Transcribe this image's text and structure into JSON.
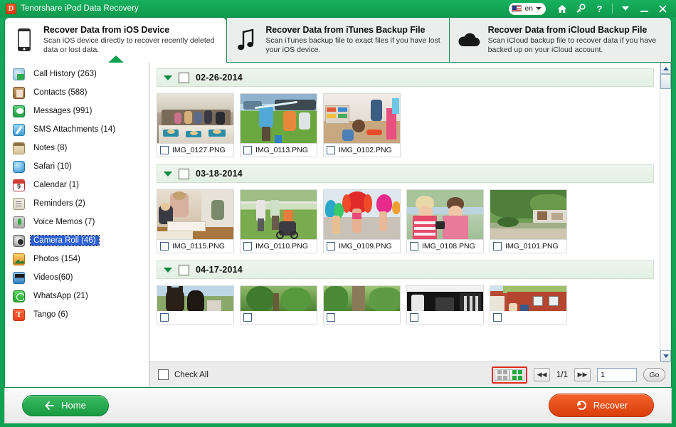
{
  "titlebar": {
    "app_icon": "app-logo-icon",
    "title": "Tenorshare iPod Data Recovery",
    "language": "en",
    "icons": [
      "home-icon",
      "key-icon",
      "help-icon",
      "chevron-down-icon",
      "minimize-icon",
      "close-icon"
    ]
  },
  "tabs": [
    {
      "title": "Recover Data from iOS Device",
      "subtitle": "Scan iOS device directly to recover recently deleted data or lost data.",
      "icon": "iphone-icon",
      "active": true
    },
    {
      "title": "Recover Data from iTunes Backup File",
      "subtitle": "Scan iTunes backup file to exact files if you have lost your iOS device.",
      "icon": "music-note-icon",
      "active": false
    },
    {
      "title": "Recover Data from iCloud Backup File",
      "subtitle": "Scan iCloud backup file to recover data if you have backed up on your iCloud account.",
      "icon": "cloud-icon",
      "active": false
    }
  ],
  "sidebar": {
    "items": [
      {
        "label": "Call History (263)",
        "icon": "call-history-icon",
        "selected": false
      },
      {
        "label": "Contacts (588)",
        "icon": "contacts-icon",
        "selected": false
      },
      {
        "label": "Messages (991)",
        "icon": "messages-icon",
        "selected": false
      },
      {
        "label": "SMS Attachments (14)",
        "icon": "sms-attachments-icon",
        "selected": false
      },
      {
        "label": "Notes (8)",
        "icon": "notes-icon",
        "selected": false
      },
      {
        "label": "Safari (10)",
        "icon": "safari-icon",
        "selected": false
      },
      {
        "label": "Calendar (1)",
        "icon": "calendar-icon",
        "selected": false
      },
      {
        "label": "Reminders (2)",
        "icon": "reminders-icon",
        "selected": false
      },
      {
        "label": "Voice Memos (7)",
        "icon": "voice-memos-icon",
        "selected": false
      },
      {
        "label": "Camera Roll (46)",
        "icon": "camera-roll-icon",
        "selected": true
      },
      {
        "label": "Photos (154)",
        "icon": "photos-icon",
        "selected": false
      },
      {
        "label": "Videos(60)",
        "icon": "videos-icon",
        "selected": false
      },
      {
        "label": "WhatsApp (21)",
        "icon": "whatsapp-icon",
        "selected": false
      },
      {
        "label": "Tango (6)",
        "icon": "tango-icon",
        "selected": false
      }
    ]
  },
  "gallery": {
    "groups": [
      {
        "date": "02-26-2014",
        "files": [
          {
            "name": "IMG_0127.PNG",
            "scene": "family-dinner-table"
          },
          {
            "name": "IMG_0113.PNG",
            "scene": "kids-water-play-lawn"
          },
          {
            "name": "IMG_0102.PNG",
            "scene": "children-playroom"
          }
        ]
      },
      {
        "date": "03-18-2014",
        "files": [
          {
            "name": "IMG_0115.PNG",
            "scene": "woman-child-reading"
          },
          {
            "name": "IMG_0110.PNG",
            "scene": "family-with-stroller"
          },
          {
            "name": "IMG_0109.PNG",
            "scene": "carnival-dancers"
          },
          {
            "name": "IMG_0108.PNG",
            "scene": "two-girls-outdoors"
          },
          {
            "name": "IMG_0101.PNG",
            "scene": "garden-house-trees"
          }
        ]
      },
      {
        "date": "04-17-2014",
        "files": [
          {
            "name": "",
            "scene": "horses-field"
          },
          {
            "name": "",
            "scene": "green-trees"
          },
          {
            "name": "",
            "scene": "tree-trunk-foliage"
          },
          {
            "name": "",
            "scene": "dark-interior"
          },
          {
            "name": "",
            "scene": "red-barn-people"
          }
        ]
      }
    ]
  },
  "footer": {
    "check_all_label": "Check All",
    "view_toggle": {
      "list_icon": "grid-small-icon",
      "grid_icon": "grid-large-icon",
      "selected": "grid-large-icon"
    },
    "prev_icon": "first-page-icon",
    "next_icon": "last-page-icon",
    "page_info": "1/1",
    "page_input_value": "1",
    "go_label": "Go"
  },
  "bottom": {
    "home_label": "Home",
    "home_icon": "arrow-left-icon",
    "recover_label": "Recover",
    "recover_icon": "undo-arrow-icon"
  },
  "colors": {
    "brand_green": "#10a152",
    "accent_orange": "#e8450f",
    "selection_blue": "#2a5fd6",
    "highlight_red": "#e02b17"
  }
}
